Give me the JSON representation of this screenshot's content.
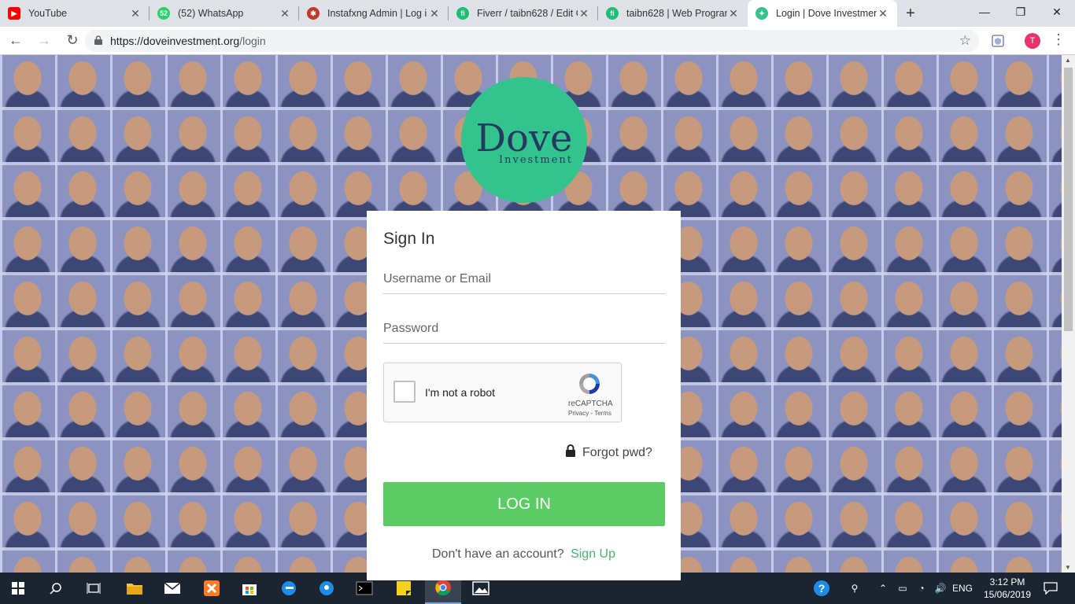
{
  "browser": {
    "tabs": [
      {
        "title": "YouTube",
        "favicon": "youtube-icon",
        "color": "#ff0000"
      },
      {
        "title": "(52) WhatsApp",
        "favicon": "whatsapp-icon",
        "color": "#25d366",
        "badge": "52"
      },
      {
        "title": "Instafxng Admin | Log i",
        "favicon": "instafxng-icon",
        "color": "#c0392b"
      },
      {
        "title": "Fiverr / taibn628 / Edit G",
        "favicon": "fiverr-icon",
        "color": "#1dbf73",
        "badge": "fi"
      },
      {
        "title": "taibn628 | Web Program",
        "favicon": "fiverr-icon",
        "color": "#1dbf73",
        "badge": "fi"
      },
      {
        "title": "Login | Dove Investmen",
        "favicon": "dove-icon",
        "color": "#33c48d",
        "active": true
      }
    ],
    "new_tab": "+",
    "url_host": "https://doveinvestment.org",
    "url_path": "/login",
    "profile_initial": "T"
  },
  "logo": {
    "brand": "Dove",
    "subtitle": "Investment",
    "color": "#33c48d"
  },
  "signin": {
    "title": "Sign In",
    "username_placeholder": "Username or Email",
    "password_placeholder": "Password",
    "recaptcha": {
      "label": "I'm not a robot",
      "name": "reCAPTCHA",
      "links": "Privacy - Terms"
    },
    "forgot": "Forgot pwd?",
    "login_button": "LOG IN",
    "no_account": "Don't have an account?",
    "signup": "Sign Up"
  },
  "taskbar": {
    "language": "ENG",
    "time": "3:12 PM",
    "date": "15/06/2019"
  }
}
